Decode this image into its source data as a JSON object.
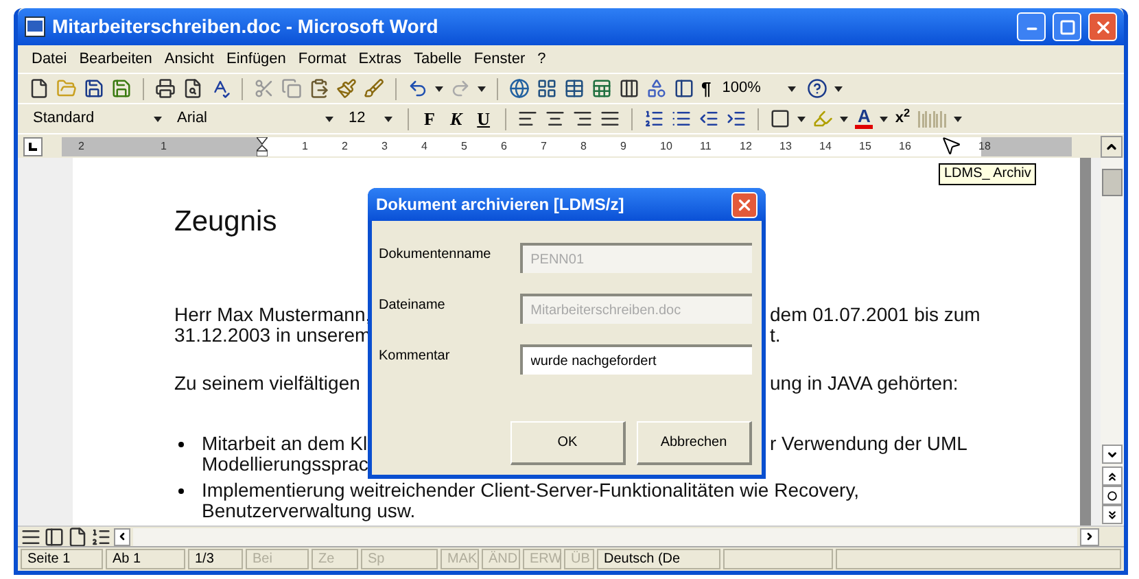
{
  "window": {
    "title": "Mitarbeiterschreiben.doc - Microsoft Word"
  },
  "menu": [
    "Datei",
    "Bearbeiten",
    "Ansicht",
    "Einfügen",
    "Format",
    "Extras",
    "Tabelle",
    "Fenster",
    "?"
  ],
  "standard_toolbar": {
    "pilcrow": "¶",
    "zoom": "100%"
  },
  "formatting_toolbar": {
    "style": "Standard",
    "font": "Arial",
    "size": "12",
    "bold": "F",
    "italic": "K",
    "underline": "U",
    "font_color": "A",
    "superscript": "x$^{2}$"
  },
  "tooltip": "LDMS_ Archiv",
  "ruler": {
    "left_labels": [
      "2",
      "1"
    ],
    "labels": [
      "1",
      "2",
      "3",
      "4",
      "5",
      "6",
      "7",
      "8",
      "9",
      "10",
      "11",
      "12",
      "13",
      "14",
      "15",
      "16",
      "18"
    ]
  },
  "document": {
    "blocks": [
      {
        "kind": "heading",
        "lines": [
          {
            "left": "Zeugnis"
          }
        ]
      },
      {
        "kind": "paragraph",
        "lines": [
          {
            "left": "Herr Max Mustermann,",
            "right": "dem 01.07.2001 bis zum"
          },
          {
            "left": "31.12.2003 in unserem",
            "right": "t."
          }
        ]
      },
      {
        "kind": "paragraph",
        "lines": [
          {
            "left": "Zu seinem vielfältigen",
            "right": "ung in JAVA gehörten:"
          }
        ]
      },
      {
        "kind": "bullet",
        "lines": [
          {
            "left": "Mitarbeit an dem Kl",
            "right": "r Verwendung der UML"
          },
          {
            "left": "Modellierungssprac"
          }
        ]
      },
      {
        "kind": "bullet",
        "lines": [
          {
            "left": "Implementierung weitreichender Client-Server-Funktionalitäten wie Recovery,"
          },
          {
            "left": "Benutzerverwaltung usw."
          }
        ]
      }
    ]
  },
  "dialog": {
    "title": "Dokument archivieren [LDMS/z]",
    "fields": [
      {
        "label": "Dokumentenname",
        "value": "PENN01",
        "disabled": true
      },
      {
        "label": "Dateiname",
        "value": "Mitarbeiterschreiben.doc",
        "disabled": true
      },
      {
        "label": "Kommentar",
        "value": "wurde nachgefordert",
        "disabled": false
      }
    ],
    "buttons": [
      "OK",
      "Abbrechen"
    ]
  },
  "status_bar": [
    {
      "text": "Seite 1",
      "disabled": false
    },
    {
      "text": "Ab 1",
      "disabled": false
    },
    {
      "text": "1/3",
      "disabled": false
    },
    {
      "text": "Bei",
      "disabled": true
    },
    {
      "text": "Ze",
      "disabled": true
    },
    {
      "text": "Sp",
      "disabled": true
    },
    {
      "text": "MAK",
      "disabled": true
    },
    {
      "text": "ÄND",
      "disabled": true
    },
    {
      "text": "ERW",
      "disabled": true
    },
    {
      "text": "ÜB",
      "disabled": true
    },
    {
      "text": "Deutsch (De",
      "disabled": false
    }
  ]
}
